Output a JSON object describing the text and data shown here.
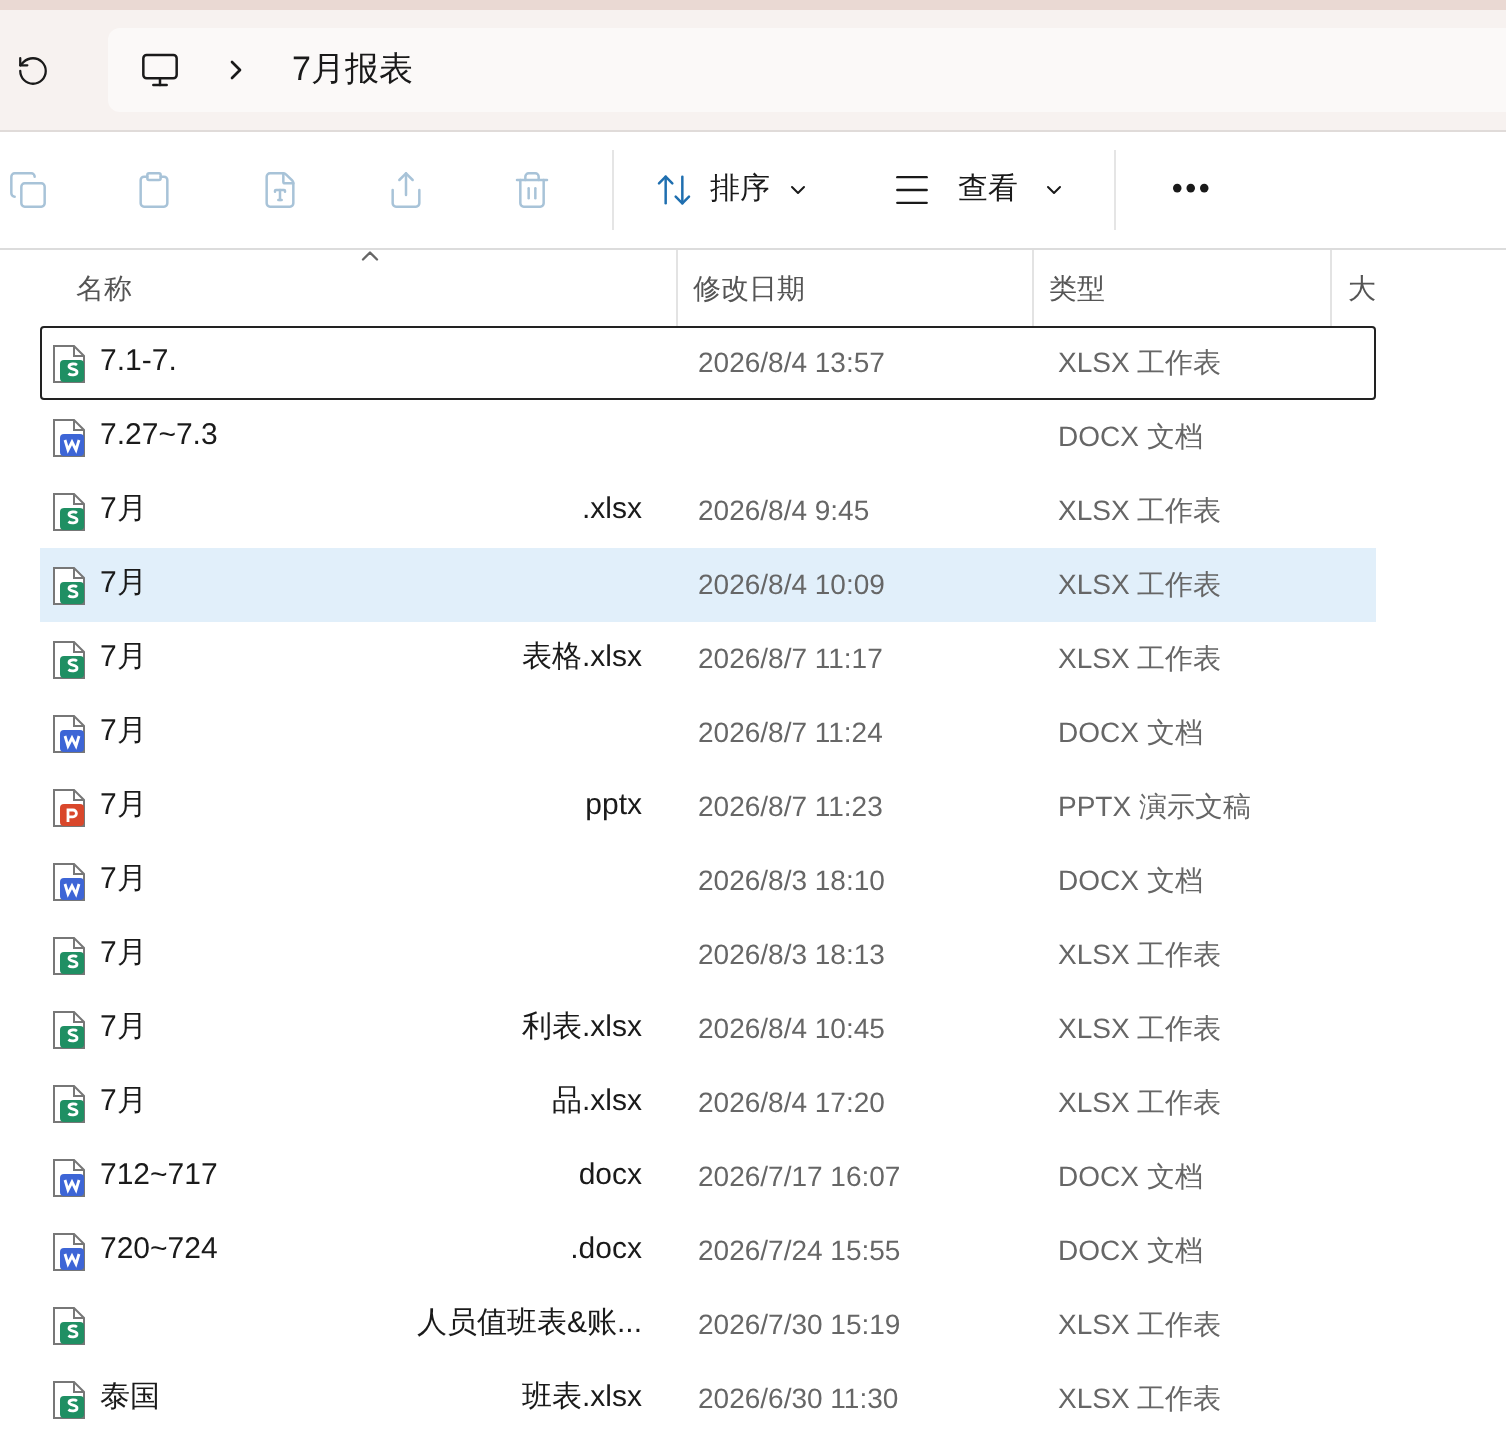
{
  "address_bar": {
    "path": "7月报表"
  },
  "toolbar": {
    "sort": "排序",
    "view": "查看",
    "more": "•••"
  },
  "table": {
    "columns": [
      "名称",
      "修改日期",
      "类型",
      "大"
    ],
    "rows": [
      {
        "kind": "xlsx",
        "name_start": "7.1-7.",
        "name_end": "",
        "date": "2026/8/4 13:57",
        "type": "XLSX 工作表",
        "selected": false,
        "focused": true
      },
      {
        "kind": "docx",
        "name_start": "7.27~7.3",
        "name_end": "",
        "date": "",
        "type": "DOCX 文档",
        "selected": false,
        "focused": false
      },
      {
        "kind": "xlsx",
        "name_start": "7月",
        "name_end": ".xlsx",
        "date": "2026/8/4 9:45",
        "type": "XLSX 工作表",
        "selected": false,
        "focused": false
      },
      {
        "kind": "xlsx",
        "name_start": "7月",
        "name_end": "",
        "date": "2026/8/4 10:09",
        "type": "XLSX 工作表",
        "selected": true,
        "focused": false
      },
      {
        "kind": "xlsx",
        "name_start": "7月",
        "name_end": "表格.xlsx",
        "date": "2026/8/7 11:17",
        "type": "XLSX 工作表",
        "selected": false,
        "focused": false
      },
      {
        "kind": "docx",
        "name_start": "7月",
        "name_end": "",
        "date": "2026/8/7 11:24",
        "type": "DOCX 文档",
        "selected": false,
        "focused": false
      },
      {
        "kind": "pptx",
        "name_start": "7月",
        "name_end": "pptx",
        "date": "2026/8/7 11:23",
        "type": "PPTX 演示文稿",
        "selected": false,
        "focused": false
      },
      {
        "kind": "docx",
        "name_start": "7月",
        "name_end": "",
        "date": "2026/8/3 18:10",
        "type": "DOCX 文档",
        "selected": false,
        "focused": false
      },
      {
        "kind": "xlsx",
        "name_start": "7月",
        "name_end": "",
        "date": "2026/8/3 18:13",
        "type": "XLSX 工作表",
        "selected": false,
        "focused": false
      },
      {
        "kind": "xlsx",
        "name_start": "7月",
        "name_end": "利表.xlsx",
        "date": "2026/8/4 10:45",
        "type": "XLSX 工作表",
        "selected": false,
        "focused": false
      },
      {
        "kind": "xlsx",
        "name_start": "7月",
        "name_end": "品.xlsx",
        "date": "2026/8/4 17:20",
        "type": "XLSX 工作表",
        "selected": false,
        "focused": false
      },
      {
        "kind": "docx",
        "name_start": "712~717",
        "name_end": "docx",
        "date": "2026/7/17 16:07",
        "type": "DOCX 文档",
        "selected": false,
        "focused": false
      },
      {
        "kind": "docx",
        "name_start": "720~724",
        "name_end": ".docx",
        "date": "2026/7/24 15:55",
        "type": "DOCX 文档",
        "selected": false,
        "focused": false
      },
      {
        "kind": "xlsx",
        "name_start": "",
        "name_end": "人员值班表&账...",
        "date": "2026/7/30 15:19",
        "type": "XLSX 工作表",
        "selected": false,
        "focused": false
      },
      {
        "kind": "xlsx",
        "name_start": "泰国",
        "name_end": "班表.xlsx",
        "date": "2026/6/30 11:30",
        "type": "XLSX 工作表",
        "selected": false,
        "focused": false
      }
    ]
  }
}
